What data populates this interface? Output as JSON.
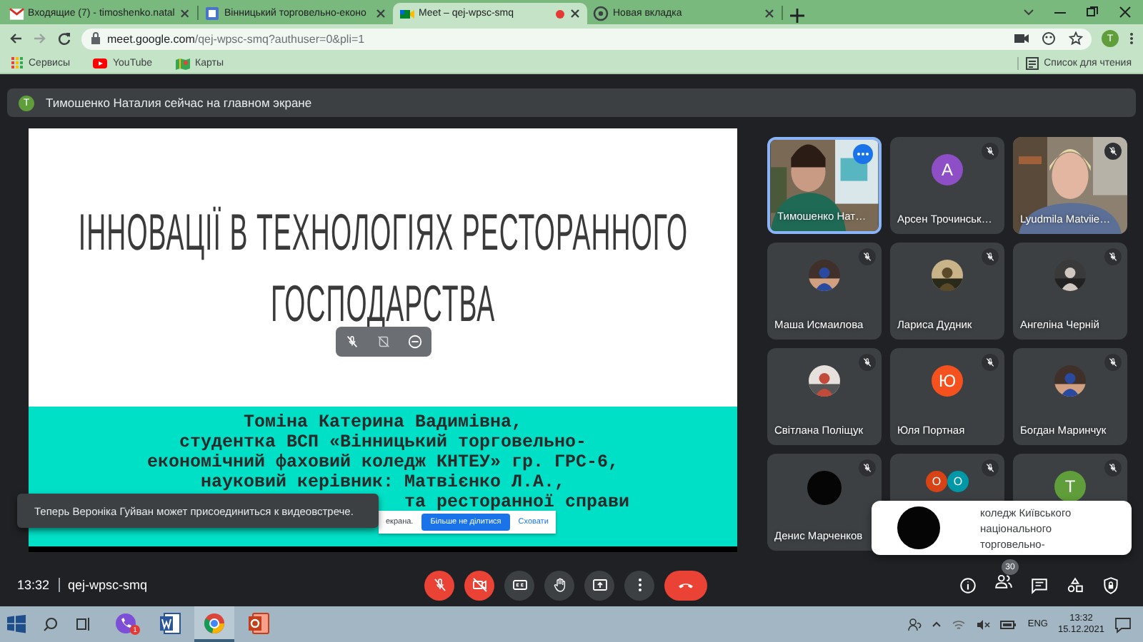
{
  "browser": {
    "tabs": [
      {
        "title": "Входящие (7) - timoshenko.natal",
        "kind": "mail",
        "selected": false,
        "recording": false
      },
      {
        "title": "Вінницький торговельно-еконо",
        "kind": "site",
        "selected": false,
        "recording": false
      },
      {
        "title": "Meet – qej-wpsc-smq",
        "kind": "meet",
        "selected": true,
        "recording": true
      },
      {
        "title": "Новая вкладка",
        "kind": "newtab",
        "selected": false,
        "recording": false
      }
    ],
    "address": {
      "host": "meet.google.com",
      "path": "/qej-wpsc-smq?authuser=0&pli=1"
    },
    "profile_initial": "T",
    "bookmarks": [
      {
        "label": "Сервисы",
        "kind": "apps"
      },
      {
        "label": "YouTube",
        "kind": "youtube"
      },
      {
        "label": "Карты",
        "kind": "maps"
      }
    ],
    "reading_list": "Список для чтения"
  },
  "banner": {
    "avatar": "T",
    "text": "Тимошенко Наталия сейчас на главном экране"
  },
  "slide": {
    "title_lines": [
      "ІННОВАЦІЇ В ТЕХНОЛОГІЯХ РЕСТОРАННОГО",
      "ГОСПОДАРСТВА"
    ],
    "author_lines": [
      "Томіна Катерина Вадимівна,",
      "студентка ВСП «Вінницький торговельно-",
      "економічний фаховий коледж КНТЕУ» гр. ГРС-6,",
      "науковий керівник: Матвієнко Л.А.,",
      "та ресторанної справи"
    ],
    "share_bar": {
      "text": "екрана.",
      "stop": "Більше не ділитися",
      "hide": "Сховати"
    }
  },
  "toast": "Теперь Вероніка Гуйван может присоединиться к видеовстрече.",
  "participants": [
    {
      "name": "Тимошенко Нат…",
      "kind": "video",
      "selected": true,
      "muted": false
    },
    {
      "name": "Арсен Трочинськ…",
      "kind": "letter",
      "letter": "А",
      "color": "#8e4ec6",
      "selected": false,
      "muted": true
    },
    {
      "name": "Lyudmila Matviie…",
      "kind": "video",
      "selected": false,
      "muted": true
    },
    {
      "name": "Маша Исмаилова",
      "selected": false,
      "muted": true
    },
    {
      "name": "Лариса Дудник",
      "selected": false,
      "muted": true
    },
    {
      "name": "Ангеліна Черній",
      "selected": false,
      "muted": true
    },
    {
      "name": "Світлана Поліщук",
      "selected": false,
      "muted": true
    },
    {
      "name": "Юля Портная",
      "kind": "letter",
      "letter": "Ю",
      "color": "#f4511e",
      "selected": false,
      "muted": true
    },
    {
      "name": "Богдан Маринчук",
      "selected": false,
      "muted": true
    },
    {
      "name": "Денис Марченков",
      "kind": "blank",
      "selected": false,
      "muted": true
    },
    {
      "kind": "group",
      "avatars": [
        {
          "letter": "О",
          "color": "#d84315"
        },
        {
          "letter": "О",
          "color": "#0097a7"
        }
      ],
      "selected": false,
      "muted": true
    },
    {
      "kind": "letter",
      "letter": "T",
      "color": "#5f9e3a",
      "selected": false,
      "muted": true
    }
  ],
  "popup": {
    "lines": [
      "коледж Київського",
      "національного",
      "торговельно-"
    ]
  },
  "call": {
    "time": "13:32",
    "code": "qej-wpsc-smq",
    "mic_on": false,
    "camera_on": false,
    "people_count": "30"
  },
  "taskbar": {
    "apps": [
      {
        "kind": "viber",
        "badge": "1",
        "selected": false
      },
      {
        "kind": "word",
        "selected": false
      },
      {
        "kind": "chrome",
        "selected": true
      },
      {
        "kind": "powerpoint",
        "selected": false
      }
    ],
    "language": "ENG",
    "time": "13:32",
    "date": "15.12.2021"
  }
}
